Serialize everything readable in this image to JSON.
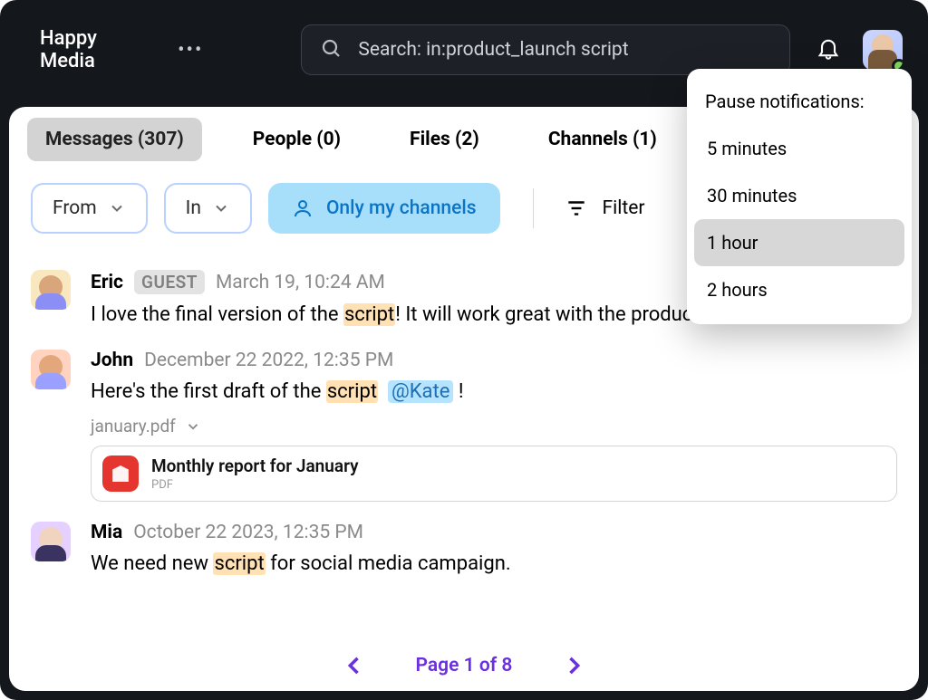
{
  "header": {
    "workspace": "Happy Media",
    "search_value": "Search: in:product_launch script"
  },
  "tabs": [
    {
      "label": "Messages (307)",
      "active": true
    },
    {
      "label": "People (0)",
      "active": false
    },
    {
      "label": "Files (2)",
      "active": false
    },
    {
      "label": "Channels (1)",
      "active": false
    }
  ],
  "filters": {
    "from": "From",
    "in": "In",
    "only_my_channels": "Only my channels",
    "filter": "Filter"
  },
  "messages": [
    {
      "author": "Eric",
      "guest": "GUEST",
      "timestamp": "March 19, 10:24 AM",
      "pre": "I love the final version of the ",
      "hl": "script",
      "post": "! It will work great with the produc"
    },
    {
      "author": "John",
      "timestamp": "December 22 2022, 12:35 PM",
      "pre": "Here's the first draft of the ",
      "hl": "script",
      "mention": "@Kate",
      "post": " !",
      "attachment_name": "january.pdf",
      "file_title": "Monthly report for January",
      "file_sub": "PDF"
    },
    {
      "author": "Mia",
      "timestamp": "October 22 2023, 12:35 PM",
      "pre": "We need new ",
      "hl": "script",
      "post": " for social media campaign."
    }
  ],
  "pager": {
    "label": "Page 1 of 8"
  },
  "notifications_menu": {
    "title": "Pause notifications:",
    "items": [
      {
        "label": "5 minutes",
        "selected": false
      },
      {
        "label": "30 minutes",
        "selected": false
      },
      {
        "label": "1 hour",
        "selected": true
      },
      {
        "label": "2 hours",
        "selected": false
      }
    ]
  }
}
